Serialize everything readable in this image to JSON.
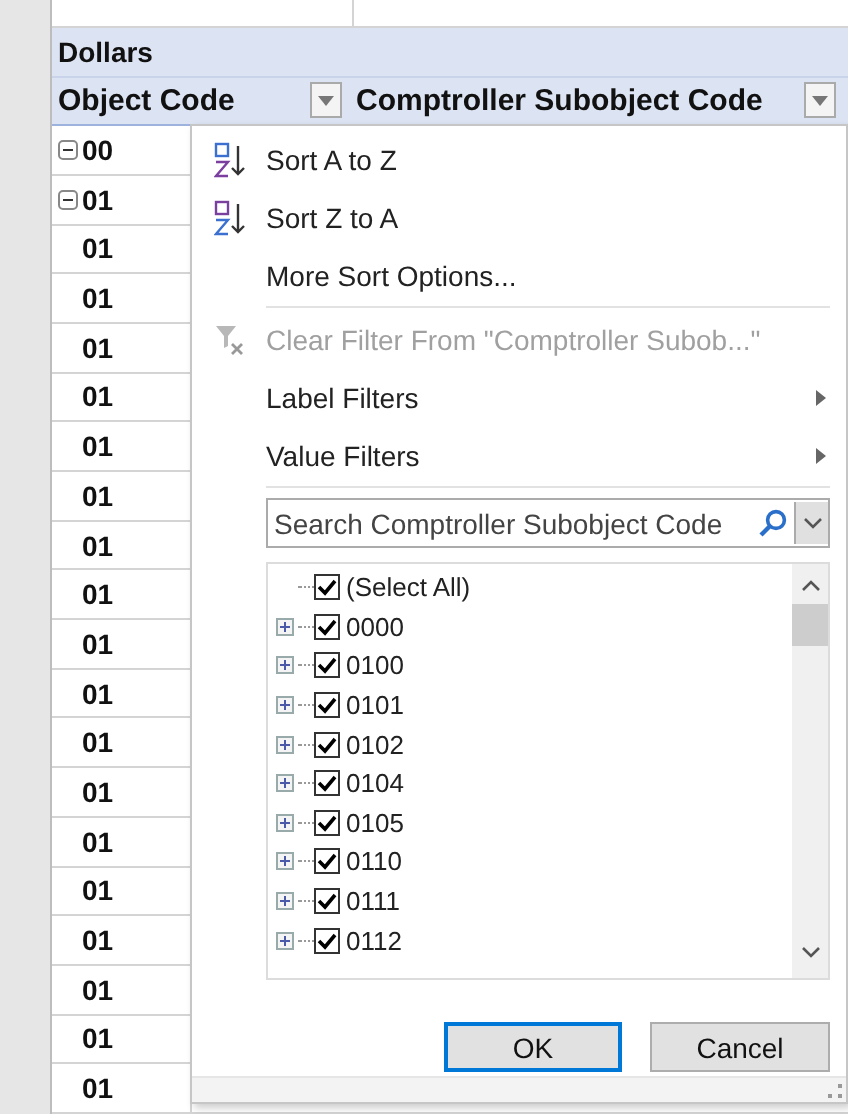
{
  "sheet": {
    "header_rows": [
      {
        "label": "Dollars"
      }
    ],
    "columns": [
      {
        "label": "Object Code"
      },
      {
        "label": "Comptroller Subobject Code"
      }
    ],
    "rows": [
      {
        "value": "00",
        "expanded": true,
        "kind": "group"
      },
      {
        "value": "01",
        "expanded": true,
        "kind": "group"
      },
      {
        "value": "01",
        "kind": "item"
      },
      {
        "value": "01",
        "kind": "item"
      },
      {
        "value": "01",
        "kind": "item"
      },
      {
        "value": "01",
        "kind": "item"
      },
      {
        "value": "01",
        "kind": "item"
      },
      {
        "value": "01",
        "kind": "item"
      },
      {
        "value": "01",
        "kind": "item"
      },
      {
        "value": "01",
        "kind": "item"
      },
      {
        "value": "01",
        "kind": "item"
      },
      {
        "value": "01",
        "kind": "item"
      },
      {
        "value": "01",
        "kind": "item"
      },
      {
        "value": "01",
        "kind": "item"
      },
      {
        "value": "01",
        "kind": "item"
      },
      {
        "value": "01",
        "kind": "item"
      },
      {
        "value": "01",
        "kind": "item"
      },
      {
        "value": "01",
        "kind": "item"
      },
      {
        "value": "01",
        "kind": "item"
      },
      {
        "value": "01",
        "kind": "item"
      }
    ]
  },
  "filter_menu": {
    "items": [
      {
        "label": "Sort A to Z",
        "kind": "sortup",
        "disabled": false
      },
      {
        "label": "Sort Z to A",
        "kind": "sortdown",
        "disabled": false
      },
      {
        "label": "More Sort Options...",
        "kind": "plain",
        "disabled": false
      },
      {
        "label": "Clear Filter From \"Comptroller Subob...\"",
        "kind": "clear",
        "disabled": true
      },
      {
        "label": "Label Filters",
        "kind": "submenu",
        "disabled": false
      },
      {
        "label": "Value Filters",
        "kind": "submenu",
        "disabled": false
      }
    ],
    "search": {
      "placeholder": "Search Comptroller Subobject Code"
    },
    "values": [
      {
        "label": "(Select All)",
        "checked": true,
        "kind": "root"
      },
      {
        "label": "0000",
        "checked": true,
        "kind": "node"
      },
      {
        "label": "0100",
        "checked": true,
        "kind": "node"
      },
      {
        "label": "0101",
        "checked": true,
        "kind": "node"
      },
      {
        "label": "0102",
        "checked": true,
        "kind": "node"
      },
      {
        "label": "0104",
        "checked": true,
        "kind": "node"
      },
      {
        "label": "0105",
        "checked": true,
        "kind": "node"
      },
      {
        "label": "0110",
        "checked": true,
        "kind": "node"
      },
      {
        "label": "0111",
        "checked": true,
        "kind": "node"
      },
      {
        "label": "0112",
        "checked": true,
        "kind": "node"
      }
    ],
    "buttons": [
      {
        "label": "OK",
        "kind": "default"
      },
      {
        "label": "Cancel",
        "kind": "normal"
      }
    ]
  }
}
